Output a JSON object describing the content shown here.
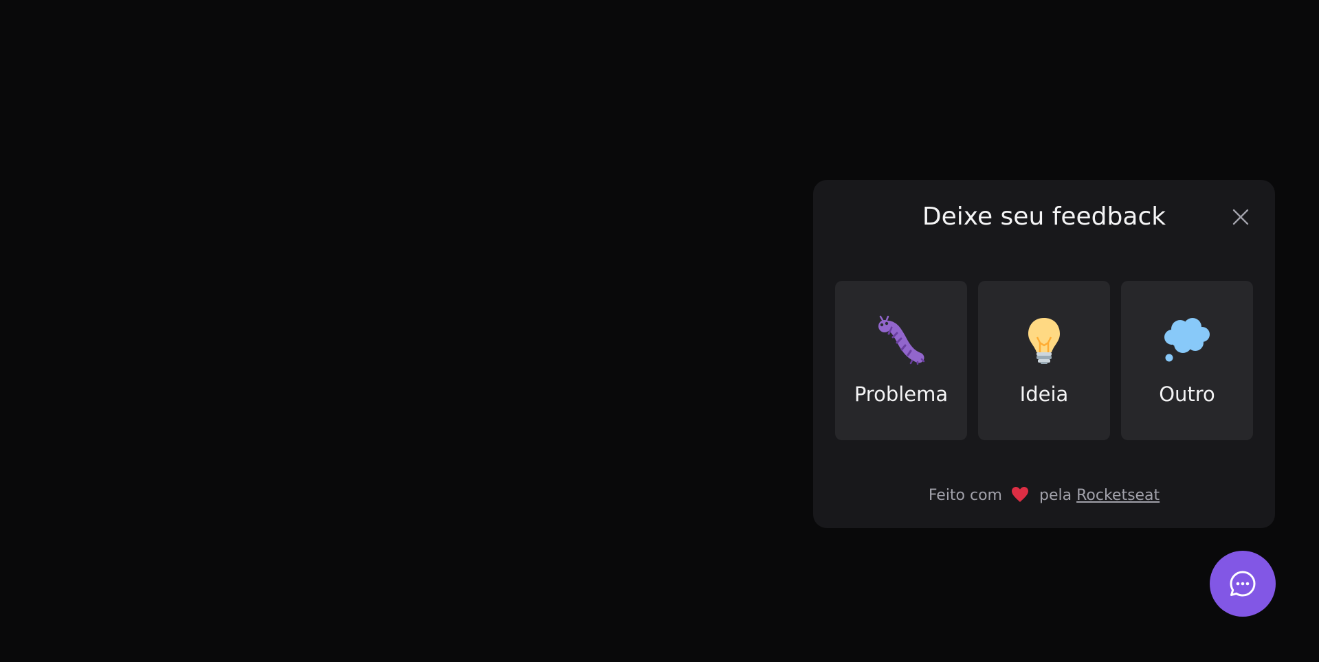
{
  "widget": {
    "title": "Deixe seu feedback",
    "close_icon": "close-icon",
    "types": [
      {
        "label": "Problema",
        "icon": "bug-icon"
      },
      {
        "label": "Ideia",
        "icon": "lightbulb-icon"
      },
      {
        "label": "Outro",
        "icon": "thought-bubble-icon"
      }
    ],
    "footer": {
      "prefix": "Feito com",
      "icon": "heart-icon",
      "middle": "pela",
      "link_text": "Rocketseat"
    }
  },
  "fab": {
    "icon": "chat-icon"
  },
  "colors": {
    "background": "#09090a",
    "panel": "#18181b",
    "card": "#27272a",
    "accent": "#8257e5",
    "text": "#f4f4f5",
    "muted_text": "#a1a1aa",
    "heart": "#dd2e44"
  }
}
